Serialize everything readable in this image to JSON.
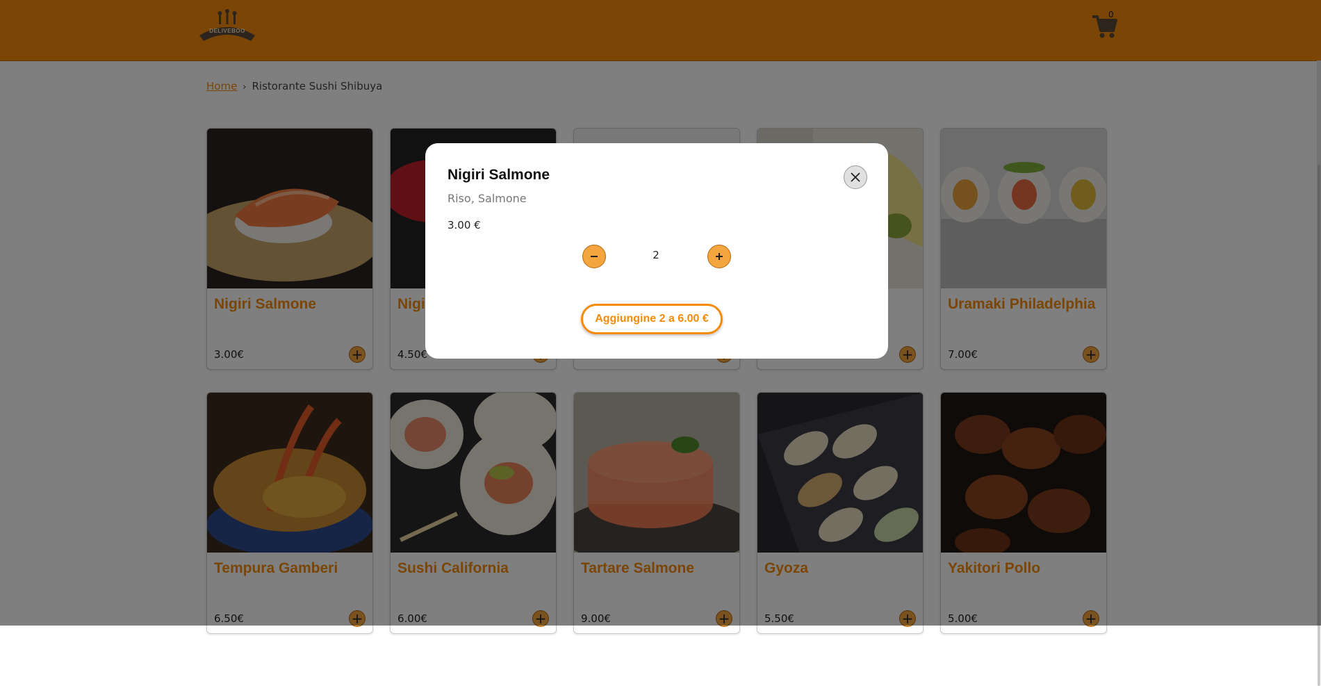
{
  "header": {
    "logo_text": "DELIVEBOO",
    "cart_count": "0",
    "accent_color": "#f48b0a"
  },
  "breadcrumb": {
    "home": "Home",
    "separator": "›",
    "current": "Ristorante Sushi Shibuya"
  },
  "menu_items": [
    {
      "name": "Nigiri Salmone",
      "price": "3.00€",
      "image": "salmon-nigiri-photo"
    },
    {
      "name": "Nigi",
      "price": "4.50€",
      "image": "tuna-nigiri-photo"
    },
    {
      "name": "",
      "price": "",
      "image": "dish-photo"
    },
    {
      "name": "",
      "price": "",
      "image": "wasabi-ginger-photo"
    },
    {
      "name": "Uramaki Philadelphia",
      "price": "7.00€",
      "image": "uramaki-photo"
    },
    {
      "name": "Tempura Gamberi",
      "price": "6.50€",
      "image": "tempura-photo"
    },
    {
      "name": "Sushi California",
      "price": "6.00€",
      "image": "california-roll-photo"
    },
    {
      "name": "Tartare Salmone",
      "price": "9.00€",
      "image": "salmon-tartare-photo"
    },
    {
      "name": "Gyoza",
      "price": "5.50€",
      "image": "gyoza-photo"
    },
    {
      "name": "Yakitori Pollo",
      "price": "5.00€",
      "image": "yakitori-photo"
    }
  ],
  "modal": {
    "title": "Nigiri Salmone",
    "description": "Riso, Salmone",
    "price": "3.00 €",
    "quantity": "2",
    "add_button": "Aggiungine 2 a 6.00 €"
  }
}
